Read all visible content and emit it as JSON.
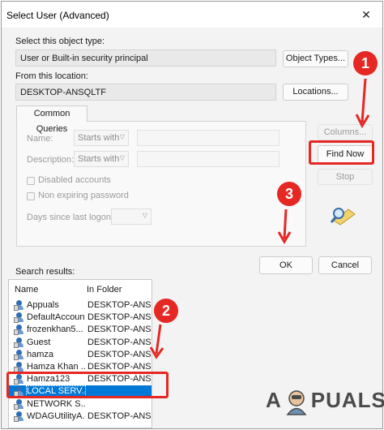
{
  "window": {
    "title": "Select User (Advanced)",
    "close_glyph": "✕"
  },
  "object_type": {
    "label": "Select this object type:",
    "value": "User or Built-in security principal",
    "button": "Object Types..."
  },
  "location": {
    "label": "From this location:",
    "value": "DESKTOP-ANSQLTF",
    "button": "Locations..."
  },
  "common_queries": {
    "tab_label": "Common Queries",
    "name_label": "Name:",
    "name_mode": "Starts with",
    "description_label": "Description:",
    "description_mode": "Starts with",
    "disabled_accounts": "Disabled accounts",
    "non_expiring": "Non expiring password",
    "days_label": "Days since last logon:"
  },
  "side_buttons": {
    "columns": "Columns...",
    "find_now": "Find Now",
    "stop": "Stop"
  },
  "dialog_buttons": {
    "ok": "OK",
    "cancel": "Cancel"
  },
  "results": {
    "label": "Search results:",
    "columns": [
      "Name",
      "In Folder"
    ],
    "rows": [
      {
        "name": "Appuals",
        "folder": "DESKTOP-ANS..."
      },
      {
        "name": "DefaultAccount",
        "folder": "DESKTOP-ANS..."
      },
      {
        "name": "frozenkhan5...",
        "folder": "DESKTOP-ANS..."
      },
      {
        "name": "Guest",
        "folder": "DESKTOP-ANS..."
      },
      {
        "name": "hamza",
        "folder": "DESKTOP-ANS..."
      },
      {
        "name": "Hamza Khan ...",
        "folder": "DESKTOP-ANS..."
      },
      {
        "name": "Hamza123",
        "folder": "DESKTOP-ANS..."
      },
      {
        "name": "LOCAL SERV...",
        "folder": ""
      },
      {
        "name": "NETWORK S...",
        "folder": ""
      },
      {
        "name": "WDAGUtilityA...",
        "folder": "DESKTOP-ANS..."
      }
    ],
    "selected_index": 7
  },
  "annotations": {
    "step1": "1",
    "step2": "2",
    "step3": "3",
    "color": "#e52824"
  },
  "watermark": {
    "left": "A",
    "right": "PUALS"
  },
  "colors": {
    "selection": "#0078d7",
    "annotation_red": "#e52824"
  }
}
